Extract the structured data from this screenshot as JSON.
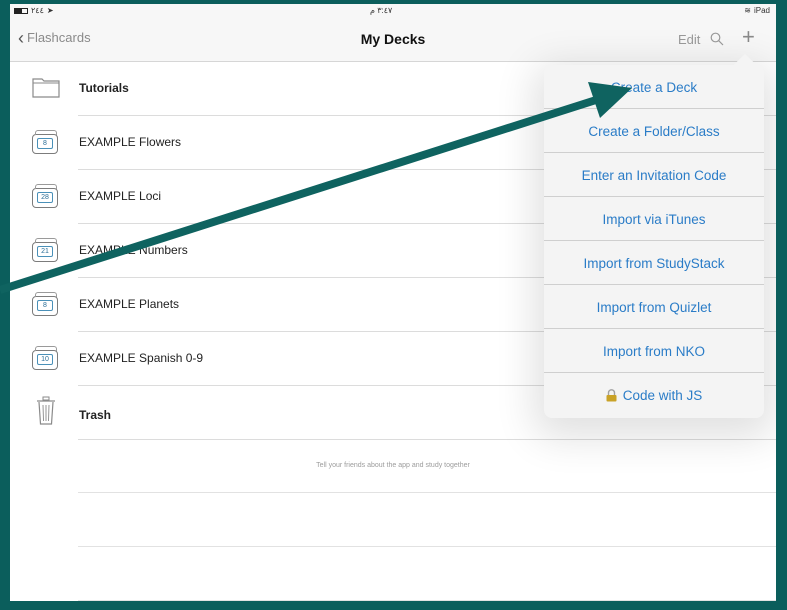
{
  "status_bar": {
    "left_text": "٢٤٤",
    "time": "٣:٤٧ م",
    "device": "iPad"
  },
  "nav": {
    "back_label": "Flashcards",
    "title": "My Decks",
    "edit_label": "Edit"
  },
  "list": {
    "items": [
      {
        "label": "Tutorials",
        "kind": "folder"
      },
      {
        "label": "EXAMPLE Flowers",
        "count": "8",
        "kind": "deck"
      },
      {
        "label": "EXAMPLE Loci",
        "count": "28",
        "kind": "deck"
      },
      {
        "label": "EXAMPLE Numbers",
        "count": "21",
        "kind": "deck"
      },
      {
        "label": "EXAMPLE Planets",
        "count": "8",
        "kind": "deck"
      },
      {
        "label": "EXAMPLE Spanish 0-9",
        "count": "10",
        "kind": "deck"
      },
      {
        "label": "Trash",
        "kind": "trash"
      }
    ],
    "footer": "Tell your friends about the app and study together"
  },
  "menu": {
    "items": [
      {
        "label": "Create a Deck"
      },
      {
        "label": "Create a Folder/Class"
      },
      {
        "label": "Enter an Invitation Code"
      },
      {
        "label": "Import via iTunes"
      },
      {
        "label": "Import from StudyStack"
      },
      {
        "label": "Import from Quizlet"
      },
      {
        "label": "Import from NKO"
      },
      {
        "label": "Code with JS",
        "icon": "lock-icon"
      }
    ]
  },
  "colors": {
    "frame": "#0b5e5c",
    "link": "#2a7cc7",
    "arrow": "#0f6360"
  }
}
